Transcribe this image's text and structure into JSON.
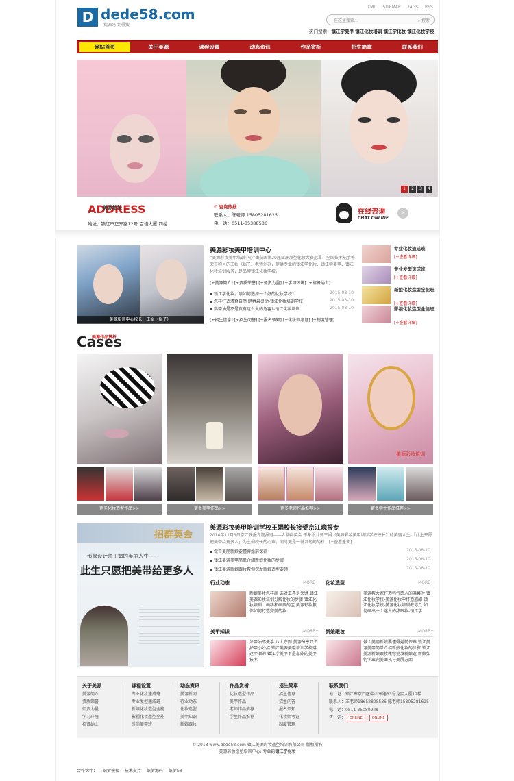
{
  "toplinks": [
    "XML",
    "SITEMAP",
    "TAGS",
    "RSS"
  ],
  "logo": {
    "mark": "D",
    "name": "dede58.com",
    "slogan": "找源码 到得搜"
  },
  "search": {
    "placeholder": "在这里搜索...",
    "button": "搜索"
  },
  "hot": {
    "label": "热门搜索：",
    "items": "镇江学美甲 镇江化妆培训 镇江学化妆 镇江化妆学校"
  },
  "nav": [
    "网站首页",
    "关于美源",
    "课程设置",
    "动态资讯",
    "作品赏析",
    "招生简章",
    "联系我们"
  ],
  "banner": {
    "dots": [
      "1",
      "2",
      "3",
      "4"
    ]
  },
  "info": {
    "addr_title": "ADDRESS",
    "addr_sub": "美源地址",
    "addr": "地址：镇江市正东路12号 百惜大厦 四楼",
    "tel_title": "咨询热线",
    "contact": "联系人：陈老师 15805281625",
    "phone": "电　话：0511-85388536",
    "online": "在线咨询",
    "online_sub": "CHAT ONLINE",
    "arrow": "›"
  },
  "about": {
    "caption": "美源培训中心校长－王娟（娟子）",
    "title": "美源彩妆美甲培训中心",
    "text": "“美源彩妆美甲培训中心”由获国第29届亚洲发型化妆大赛冠军、全国技术能手等荣誉称号的王娟（娟子）老师创办，提供专业的镇江学化妆、镇江学美甲、镇江化妆培训服务，是品牌镇江化妆学校。",
    "tags1": "[+美源简介]  [+资质荣誉]  [+师资力量]  [+学习环境]  [+招贤纳士]",
    "news": [
      {
        "t": "镇江学化妆，该如何选择一个好的化妆学校?",
        "d": "2015-08-10"
      },
      {
        "t": "怎样打造清爽自然 踏春最灵动-镇江化妆培训学校",
        "d": "2015-08-10"
      },
      {
        "t": "指甲油是不是真有这么大的危害?-镇江化妆培训",
        "d": "2015-08-10"
      }
    ],
    "tags2": "[+招生信息]  [+招生问答]  [+报名须知]  [+化妆师考证]  [+制度管理]"
  },
  "side": [
    {
      "t": "专业化妆速成班",
      "m": "[+查看详细]"
    },
    {
      "t": "专业发型速成班",
      "m": "[+查看详细]"
    },
    {
      "t": "新娘化妆造型全能班",
      "m": "[+查看详细]"
    },
    {
      "t": "影视化妆造型全能班",
      "m": "[+查看详细]"
    }
  ],
  "cases": {
    "title": "Cases",
    "sub": "美源作品赏析",
    "buttons": [
      "更多化妆造型作品>>",
      "更多美甲作品>>",
      "更多老师作品推荐>>",
      "更多学生作品推荐>>"
    ],
    "watermark": "美源彩妆培训"
  },
  "ad": {
    "head": "招群英会",
    "line1": "形象设计师王娟的美丽人生——",
    "line2": "此生只愿把美带给更多人"
  },
  "school": {
    "title": "美源彩妆美甲培训学校王娟校长接受京江晚报专",
    "text": "2014年11月3日京江晚报专题报道——人物群英会 形象设计师王娟（美源彩妆美甲培训学校校长）的美丽人生-「此生只愿把美带给更多人」为主娟校长的心声，同时更是一份沉甸甸的社...[+查看全文]",
    "news": [
      {
        "t": "做个美丽新娘要懂得婚前保养",
        "d": "2015-08-10"
      },
      {
        "t": "镇江美源美甲简单介绍新娘化妆的步骤",
        "d": "2015-08-10"
      },
      {
        "t": "镇江美源新娘跟妆教你挖发新娘造型要领",
        "d": "2015-08-10"
      }
    ]
  },
  "boxes": [
    {
      "title": "行业动态",
      "more": "MORE+",
      "text": "新娘美妆怎样画 选对工具是关键 镇江美源彩妆培训分解化妆的步骤 镇江化妆培训：画粉和画眉的区 美源彩妆教你如何打造完美的妆"
    },
    {
      "title": "化妆造型",
      "more": "MORE+",
      "text": "美源教大家打造韩气感人的温馨时 镇江化妆学校-美源化妆中打造翘甜 镇江化妆学校-美源化妆培训教你几 如何画出一个迷人的甜眼妆-镇江学"
    },
    {
      "title": "美甲知识",
      "more": "MORE+",
      "text": "涂甲油不失手 八大守则 美源分享几个护甲小妙招 镇江美源美甲培训学校讲述甲油的 镇江学美甲不是靠外的美甲技术"
    },
    {
      "title": "新娘跟妆",
      "more": "MORE+",
      "text": "做个美丽新娘要懂得婚前保养 镇江美源美甲简单介绍新娘化妆的步骤 镇江美源新娘跟妆教你挖发新娘造 新娘如何学出完美面孔与美肌方面"
    }
  ],
  "footer": {
    "cols": [
      {
        "h": "关于美源",
        "items": [
          "美源简介",
          "资质荣誉",
          "师资力量",
          "学习环境",
          "招贤纳士"
        ]
      },
      {
        "h": "课程设置",
        "items": [
          "专业化妆速成班",
          "专业发型速成班",
          "新娘化妆造型全能",
          "影视化妆造型全能",
          "时尚美甲班"
        ]
      },
      {
        "h": "动态资讯",
        "items": [
          "美源新闻",
          "行业动态",
          "化妆造型",
          "美甲知识",
          "新娘跟妆"
        ]
      },
      {
        "h": "作品赏析",
        "items": [
          "化妆造型作品",
          "美甲作品",
          "老师作品推荐",
          "学生作品推荐"
        ]
      },
      {
        "h": "招生简章",
        "items": [
          "招生信息",
          "招生问答",
          "报名须知",
          "化妆师考证",
          "制度管理"
        ]
      }
    ],
    "contact": {
      "h": "联系我们",
      "lines": [
        "地　址：镇江市京口区中山东路33号龙实大厦12楼",
        "联系人：王老师18652895536 陈老师15805281625",
        "电　话：0511-85080928",
        "咨　询："
      ]
    },
    "qqbtns": [
      "ONLINE",
      "ONLINE"
    ]
  },
  "copy": {
    "l1": "© 2013 www.dede58.com 镇江美源彩妆造型培训有限公司 版权所有",
    "l2": "美源彩妆造型培训中心: 专业的",
    "l2b": "镇江学化妆"
  },
  "partner": {
    "label": "合作伙伴：",
    "items": [
      "织梦模板",
      "技术支持",
      "织梦源码",
      "织梦58"
    ]
  }
}
